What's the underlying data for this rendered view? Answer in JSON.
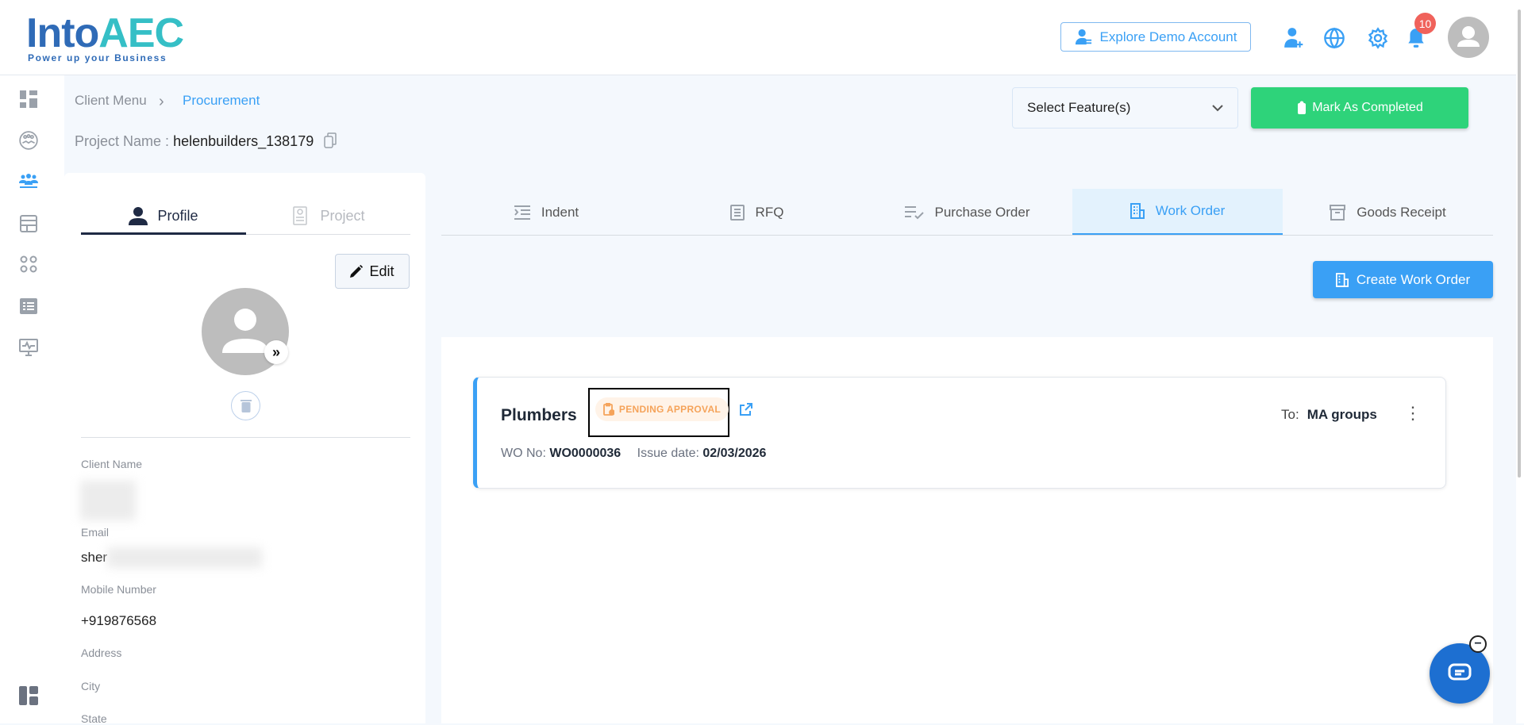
{
  "header": {
    "logo_text": "IntoAEC",
    "logo_tagline": "Power up your Business",
    "explore_label": "Explore Demo Account",
    "notification_count": "10"
  },
  "breadcrumb": {
    "parent": "Client Menu",
    "current": "Procurement"
  },
  "project": {
    "label": "Project Name :",
    "value": "helenbuilders_138179"
  },
  "toolbar": {
    "select_placeholder": "Select Feature(s)",
    "mark_completed": "Mark As Completed"
  },
  "profile_panel": {
    "tabs": [
      "Profile",
      "Project"
    ],
    "edit_label": "Edit",
    "fields": [
      {
        "label": "Client Name",
        "value": ""
      },
      {
        "label": "Email",
        "value": "sher"
      },
      {
        "label": "Mobile Number",
        "value": "+919876568"
      },
      {
        "label": "Address",
        "value": ""
      },
      {
        "label": "City",
        "value": ""
      },
      {
        "label": "State",
        "value": ""
      }
    ]
  },
  "tabs": [
    "Indent",
    "RFQ",
    "Purchase Order",
    "Work Order",
    "Goods Receipt"
  ],
  "active_tab": "Work Order",
  "create_label": "Create Work Order",
  "work_order": {
    "title": "Plumbers",
    "status": "PENDING APPROVAL",
    "wo_label": "WO No:",
    "wo_no": "WO0000036",
    "issue_label": "Issue date:",
    "issue_date": "02/03/2026",
    "to_label": "To:",
    "to_value": "MA groups"
  },
  "colors": {
    "accent": "#3aa0f5",
    "success": "#2ed37a",
    "pending": "#f5a35a",
    "badge": "#f0625b"
  }
}
